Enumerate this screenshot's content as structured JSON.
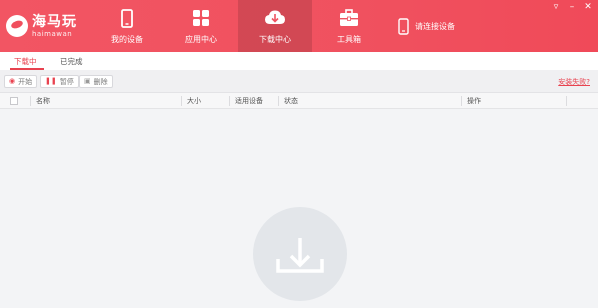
{
  "app": {
    "logo_title": "海马玩",
    "logo_sub": "haimawan"
  },
  "nav": {
    "my_device": "我的设备",
    "app_center": "应用中心",
    "download_center": "下载中心",
    "toolbox": "工具箱",
    "connect_device": "请连接设备"
  },
  "tabs": {
    "downloading": "下载中",
    "completed": "已完成"
  },
  "toolbar": {
    "start": "开始",
    "pause": "暂停",
    "delete": "删除",
    "install_failed": "安装失败?"
  },
  "table": {
    "columns": [
      "名称",
      "大小",
      "适用设备",
      "状态",
      "操作"
    ]
  },
  "colors": {
    "brand_red": "#f0515f",
    "accent_red": "#e8424f"
  },
  "icons": {
    "my_device": "phone-icon",
    "app_center": "grid-icon",
    "download_center": "cloud-download-icon",
    "toolbox": "toolbox-icon",
    "connect_device": "phone-outline-icon",
    "empty_state": "download-icon"
  }
}
